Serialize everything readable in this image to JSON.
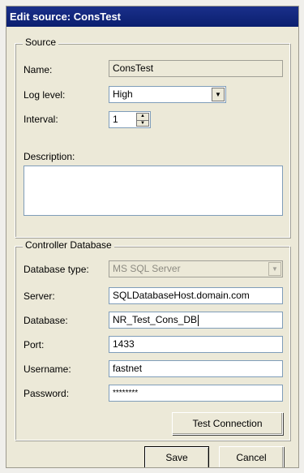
{
  "window": {
    "title": "Edit source: ConsTest"
  },
  "source": {
    "group_label": "Source",
    "name_label": "Name:",
    "name_value": "ConsTest",
    "loglevel_label": "Log level:",
    "loglevel_value": "High",
    "interval_label": "Interval:",
    "interval_value": "1",
    "description_label": "Description:",
    "description_value": ""
  },
  "controller": {
    "group_label": "Controller Database",
    "dbtype_label": "Database type:",
    "dbtype_value": "MS SQL Server",
    "server_label": "Server:",
    "server_value": "SQLDatabaseHost.domain.com",
    "database_label": "Database:",
    "database_value": "NR_Test_Cons_DB",
    "port_label": "Port:",
    "port_value": "1433",
    "username_label": "Username:",
    "username_value": "fastnet",
    "password_label": "Password:",
    "password_value": "********",
    "test_button": "Test Connection"
  },
  "footer": {
    "save_label": "Save",
    "cancel_label": "Cancel"
  },
  "icons": {
    "dropdown": "chevron-down-icon",
    "spin_up": "spin-up-icon",
    "spin_down": "spin-down-icon"
  },
  "colors": {
    "titlebar": "#0b1f6f",
    "dialog_bg": "#ece9d8"
  }
}
